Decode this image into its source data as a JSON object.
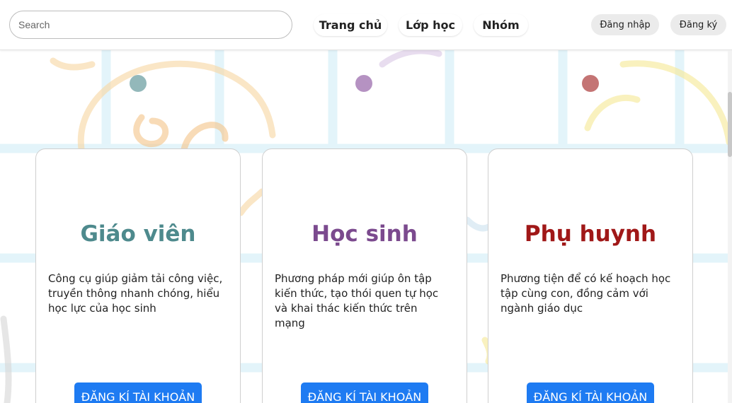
{
  "header": {
    "search_placeholder": "Search",
    "nav": [
      "Trang chủ",
      "Lớp học",
      "Nhóm"
    ],
    "login_label": "Đăng nhập",
    "signup_label": "Đăng ký"
  },
  "cards": [
    {
      "title": "Giáo viên",
      "description": "Công cụ giúp giảm tải công việc, truyền thông nhanh chóng, hiểu học lực của học sinh",
      "button_label": "ĐĂNG KÍ TÀI KHOẢN",
      "accent_color": "#4e8a8d",
      "dot_color": "#93b8ba"
    },
    {
      "title": "Học sinh",
      "description": "Phương pháp mới giúp ôn tập kiến thức, tạo thói quen tự học và khai thác kiến thức trên mạng",
      "button_label": "ĐĂNG KÍ TÀI KHOẢN",
      "accent_color": "#7b4a8e",
      "dot_color": "#b592c2"
    },
    {
      "title": "Phụ huynh",
      "description": "Phương tiện để có kế hoạch học tập cùng con, đồng cảm với ngành giáo dục",
      "button_label": "ĐĂNG KÍ TÀI KHOẢN",
      "accent_color": "#a01818",
      "dot_color": "#c47474"
    }
  ],
  "colors": {
    "primary_button": "#1e7bf2",
    "grid_line": "#e3f4fa"
  }
}
